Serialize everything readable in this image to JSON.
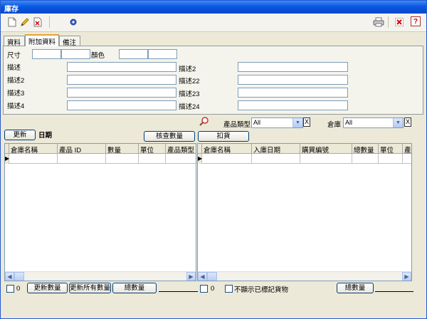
{
  "window": {
    "title": "庫存"
  },
  "toolbar": {
    "icons": [
      "new-icon",
      "edit-icon",
      "delete-icon",
      "settings-icon",
      "print-icon",
      "close-icon",
      "help-icon"
    ],
    "help_glyph": "?"
  },
  "tabs": [
    {
      "label": "資料"
    },
    {
      "label": "附加資料"
    },
    {
      "label": "備注"
    }
  ],
  "panel": {
    "size_label": "尺寸",
    "color_label": "顏色",
    "left_desc": [
      "描述",
      "描述2",
      "描述3",
      "描述4"
    ],
    "mid_desc": [
      "描述2",
      "描述22",
      "描述23",
      "描述24"
    ]
  },
  "filter": {
    "category_label": "產品類型",
    "category_value": "All",
    "warehouse_label": "倉庫",
    "warehouse_value": "All",
    "clear_glyph": "X"
  },
  "actions": {
    "update_label": "更新",
    "date_label": "日期",
    "check_qty_label": "核查數量",
    "deduct_label": "扣貨"
  },
  "left_grid": {
    "columns": [
      "倉庫名稱",
      "產品 ID",
      "數量",
      "單位",
      "產品類型"
    ]
  },
  "right_grid": {
    "columns": [
      "倉庫名稱",
      "入庫日期",
      "購買編號",
      "總數量",
      "單位",
      "產"
    ]
  },
  "footer": {
    "left_count": "0",
    "update_qty_label": "更新數量",
    "update_all_qty_label": "更新所有數量",
    "left_total_label": "總數量",
    "right_count": "0",
    "hide_marked_label": "不顯示已標記貨物",
    "right_total_label": "總數量"
  },
  "colors": {
    "titlebar": "#0a58e0",
    "window_bg": "#ECE9D8",
    "grid_border": "#7f9db9"
  }
}
